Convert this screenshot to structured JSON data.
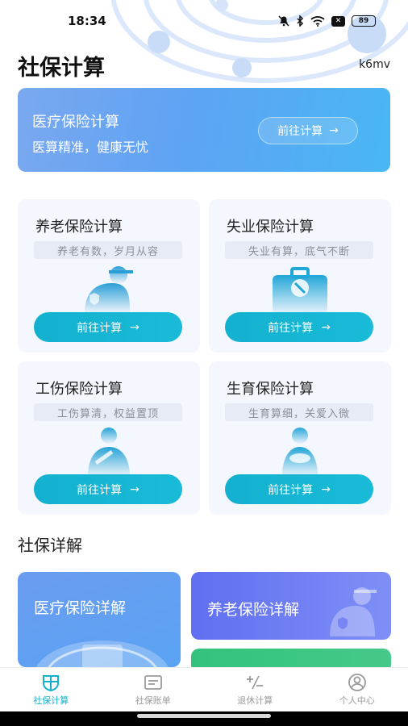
{
  "status": {
    "time": "18:34",
    "battery": "89",
    "icons": [
      "mute-icon",
      "bluetooth-icon",
      "wifi-icon",
      "x-icon",
      "battery-icon"
    ]
  },
  "header": {
    "title": "社保计算",
    "user_id": "k6mv"
  },
  "banner": {
    "title": "医疗保险计算",
    "subtitle": "医算精准，健康无忧",
    "button_label": "前往计算"
  },
  "cards": [
    {
      "title": "养老保险计算",
      "subtitle": "养老有数，岁月从容",
      "button_label": "前往计算",
      "icon": "elderly-person-icon"
    },
    {
      "title": "失业保险计算",
      "subtitle": "失业有算，底气不断",
      "button_label": "前往计算",
      "icon": "briefcase-icon"
    },
    {
      "title": "工伤保险计算",
      "subtitle": "工伤算清，权益置顶",
      "button_label": "前往计算",
      "icon": "injured-person-icon"
    },
    {
      "title": "生育保险计算",
      "subtitle": "生育算细，关爱入微",
      "button_label": "前往计算",
      "icon": "mother-baby-icon"
    }
  ],
  "details": {
    "section_title": "社保详解",
    "items": [
      {
        "title": "医疗保险详解"
      },
      {
        "title": "养老保险详解"
      }
    ]
  },
  "tabbar": {
    "items": [
      {
        "label": "社保计算",
        "active": true,
        "icon": "shield-calc-icon"
      },
      {
        "label": "社保账单",
        "active": false,
        "icon": "bill-icon"
      },
      {
        "label": "退休计算",
        "active": false,
        "icon": "plus-minus-icon"
      },
      {
        "label": "个人中心",
        "active": false,
        "icon": "user-icon"
      }
    ]
  },
  "colors": {
    "accent": "#14b1cf",
    "banner_start": "#7aa8ef",
    "banner_end": "#49b7f3"
  }
}
